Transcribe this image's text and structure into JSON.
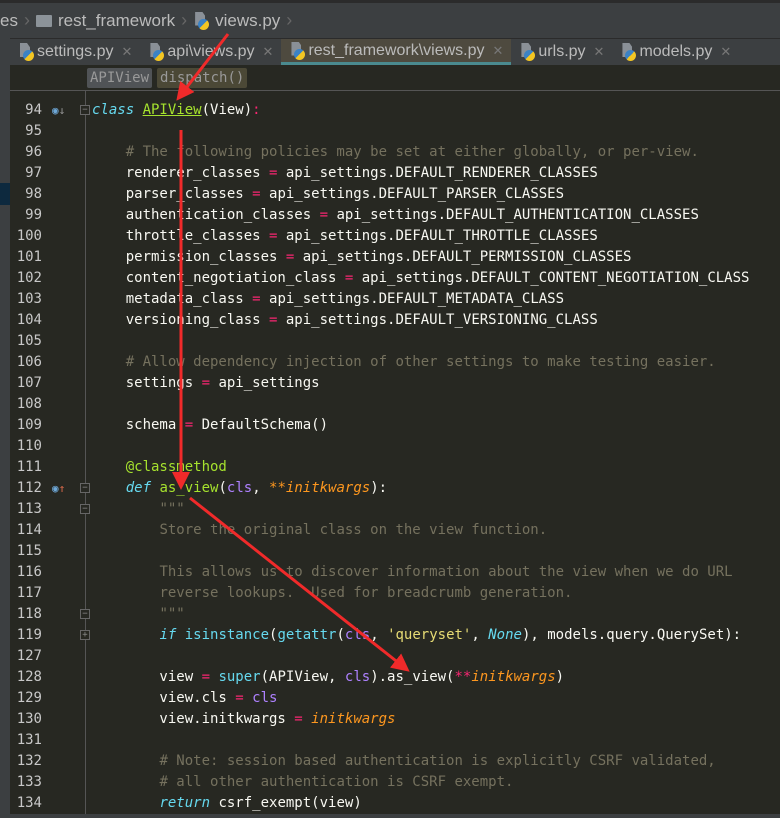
{
  "breadcrumb": [
    {
      "label": "es",
      "icon": "none"
    },
    {
      "label": "rest_framework",
      "icon": "folder-icon"
    },
    {
      "label": "views.py",
      "icon": "python-file-icon"
    }
  ],
  "tabs": [
    {
      "label": "settings.py",
      "active": false
    },
    {
      "label": "api\\views.py",
      "active": false
    },
    {
      "label": "rest_framework\\views.py",
      "active": true
    },
    {
      "label": "urls.py",
      "active": false
    },
    {
      "label": "models.py",
      "active": false
    }
  ],
  "structure": [
    "APIView",
    "dispatch()"
  ],
  "lines": [
    {
      "n": "94",
      "g": "o↓",
      "f": "-",
      "t": [
        [
          "kw",
          "class "
        ],
        [
          "fnu",
          "APIView"
        ],
        [
          "",
          "(View)"
        ],
        [
          "op",
          ":"
        ]
      ]
    },
    {
      "n": "95",
      "t": []
    },
    {
      "n": "96",
      "t": [
        [
          "",
          "    "
        ],
        [
          "cm",
          "# The following policies may be set at either globally, or per-view."
        ]
      ]
    },
    {
      "n": "97",
      "t": [
        [
          "",
          "    renderer_classes "
        ],
        [
          "op",
          "="
        ],
        [
          "",
          " api_settings.DEFAULT_RENDERER_CLASSES"
        ]
      ]
    },
    {
      "n": "98",
      "t": [
        [
          "",
          "    parser_classes "
        ],
        [
          "op",
          "="
        ],
        [
          "",
          " api_settings.DEFAULT_PARSER_CLASSES"
        ]
      ]
    },
    {
      "n": "99",
      "t": [
        [
          "",
          "    authentication_classes "
        ],
        [
          "op",
          "="
        ],
        [
          "",
          " api_settings.DEFAULT_AUTHENTICATION_CLASSES"
        ]
      ]
    },
    {
      "n": "100",
      "t": [
        [
          "",
          "    throttle_classes "
        ],
        [
          "op",
          "="
        ],
        [
          "",
          " api_settings.DEFAULT_THROTTLE_CLASSES"
        ]
      ]
    },
    {
      "n": "101",
      "t": [
        [
          "",
          "    permission_classes "
        ],
        [
          "op",
          "="
        ],
        [
          "",
          " api_settings.DEFAULT_PERMISSION_CLASSES"
        ]
      ]
    },
    {
      "n": "102",
      "t": [
        [
          "",
          "    content_negotiation_class "
        ],
        [
          "op",
          "="
        ],
        [
          "",
          " api_settings.DEFAULT_CONTENT_NEGOTIATION_CLASS"
        ]
      ]
    },
    {
      "n": "103",
      "t": [
        [
          "",
          "    metadata_class "
        ],
        [
          "op",
          "="
        ],
        [
          "",
          " api_settings.DEFAULT_METADATA_CLASS"
        ]
      ]
    },
    {
      "n": "104",
      "t": [
        [
          "",
          "    versioning_class "
        ],
        [
          "op",
          "="
        ],
        [
          "",
          " api_settings.DEFAULT_VERSIONING_CLASS"
        ]
      ]
    },
    {
      "n": "105",
      "t": []
    },
    {
      "n": "106",
      "t": [
        [
          "",
          "    "
        ],
        [
          "cm",
          "# Allow dependency injection of other settings to make testing easier."
        ]
      ]
    },
    {
      "n": "107",
      "t": [
        [
          "",
          "    settings "
        ],
        [
          "op",
          "="
        ],
        [
          "",
          " api_settings"
        ]
      ]
    },
    {
      "n": "108",
      "t": []
    },
    {
      "n": "109",
      "t": [
        [
          "",
          "    schema "
        ],
        [
          "op",
          "="
        ],
        [
          "",
          " DefaultSchema()"
        ]
      ]
    },
    {
      "n": "110",
      "t": []
    },
    {
      "n": "111",
      "t": [
        [
          "",
          "    "
        ],
        [
          "dc",
          "@classmethod"
        ]
      ]
    },
    {
      "n": "112",
      "g": "o↑",
      "f": "-",
      "t": [
        [
          "",
          "    "
        ],
        [
          "kw",
          "def "
        ],
        [
          "fn",
          "as_view"
        ],
        [
          "",
          "("
        ],
        [
          "cl",
          "cls"
        ],
        [
          "",
          ", "
        ],
        [
          "pa",
          "**initkwargs"
        ],
        [
          "",
          "):"
        ]
      ]
    },
    {
      "n": "113",
      "f": "-",
      "t": [
        [
          "",
          "        "
        ],
        [
          "ds",
          "\"\"\""
        ]
      ]
    },
    {
      "n": "114",
      "t": [
        [
          "",
          "        "
        ],
        [
          "ds",
          "Store the original class on the view function."
        ]
      ]
    },
    {
      "n": "115",
      "t": []
    },
    {
      "n": "116",
      "t": [
        [
          "",
          "        "
        ],
        [
          "ds",
          "This allows us to discover information about the view when we do URL"
        ]
      ]
    },
    {
      "n": "117",
      "t": [
        [
          "",
          "        "
        ],
        [
          "ds",
          "reverse lookups.  Used for breadcrumb generation."
        ]
      ]
    },
    {
      "n": "118",
      "f": "-",
      "t": [
        [
          "",
          "        "
        ],
        [
          "ds",
          "\"\"\""
        ]
      ]
    },
    {
      "n": "119",
      "f": "+",
      "t": [
        [
          "",
          "        "
        ],
        [
          "kw",
          "if "
        ],
        [
          "bi",
          "isinstance"
        ],
        [
          "",
          "("
        ],
        [
          "bi",
          "getattr"
        ],
        [
          "",
          "("
        ],
        [
          "cl",
          "cls"
        ],
        [
          "",
          ", "
        ],
        [
          "st",
          "'queryset'"
        ],
        [
          "",
          ", "
        ],
        [
          "kw",
          "None"
        ],
        [
          "",
          "), models.query.QuerySet):"
        ]
      ]
    },
    {
      "n": "127",
      "t": []
    },
    {
      "n": "128",
      "t": [
        [
          "",
          "        view "
        ],
        [
          "op",
          "="
        ],
        [
          "",
          " "
        ],
        [
          "bi",
          "super"
        ],
        [
          "",
          "(APIView, "
        ],
        [
          "cl",
          "cls"
        ],
        [
          "",
          ").as_view("
        ],
        [
          "op",
          "**"
        ],
        [
          "pa",
          "initkwargs"
        ],
        [
          "",
          ")"
        ]
      ]
    },
    {
      "n": "129",
      "t": [
        [
          "",
          "        view.cls "
        ],
        [
          "op",
          "="
        ],
        [
          "",
          " "
        ],
        [
          "cl",
          "cls"
        ]
      ]
    },
    {
      "n": "130",
      "t": [
        [
          "",
          "        view.initkwargs "
        ],
        [
          "op",
          "="
        ],
        [
          "",
          " "
        ],
        [
          "pa",
          "initkwargs"
        ]
      ]
    },
    {
      "n": "131",
      "t": []
    },
    {
      "n": "132",
      "t": [
        [
          "",
          "        "
        ],
        [
          "cm",
          "# Note: session based authentication is explicitly CSRF validated,"
        ]
      ]
    },
    {
      "n": "133",
      "t": [
        [
          "",
          "        "
        ],
        [
          "cm",
          "# all other authentication is CSRF exempt."
        ]
      ]
    },
    {
      "n": "134",
      "t": [
        [
          "",
          "        "
        ],
        [
          "kw",
          "return "
        ],
        [
          "",
          "csrf_exempt(view)"
        ]
      ]
    }
  ]
}
